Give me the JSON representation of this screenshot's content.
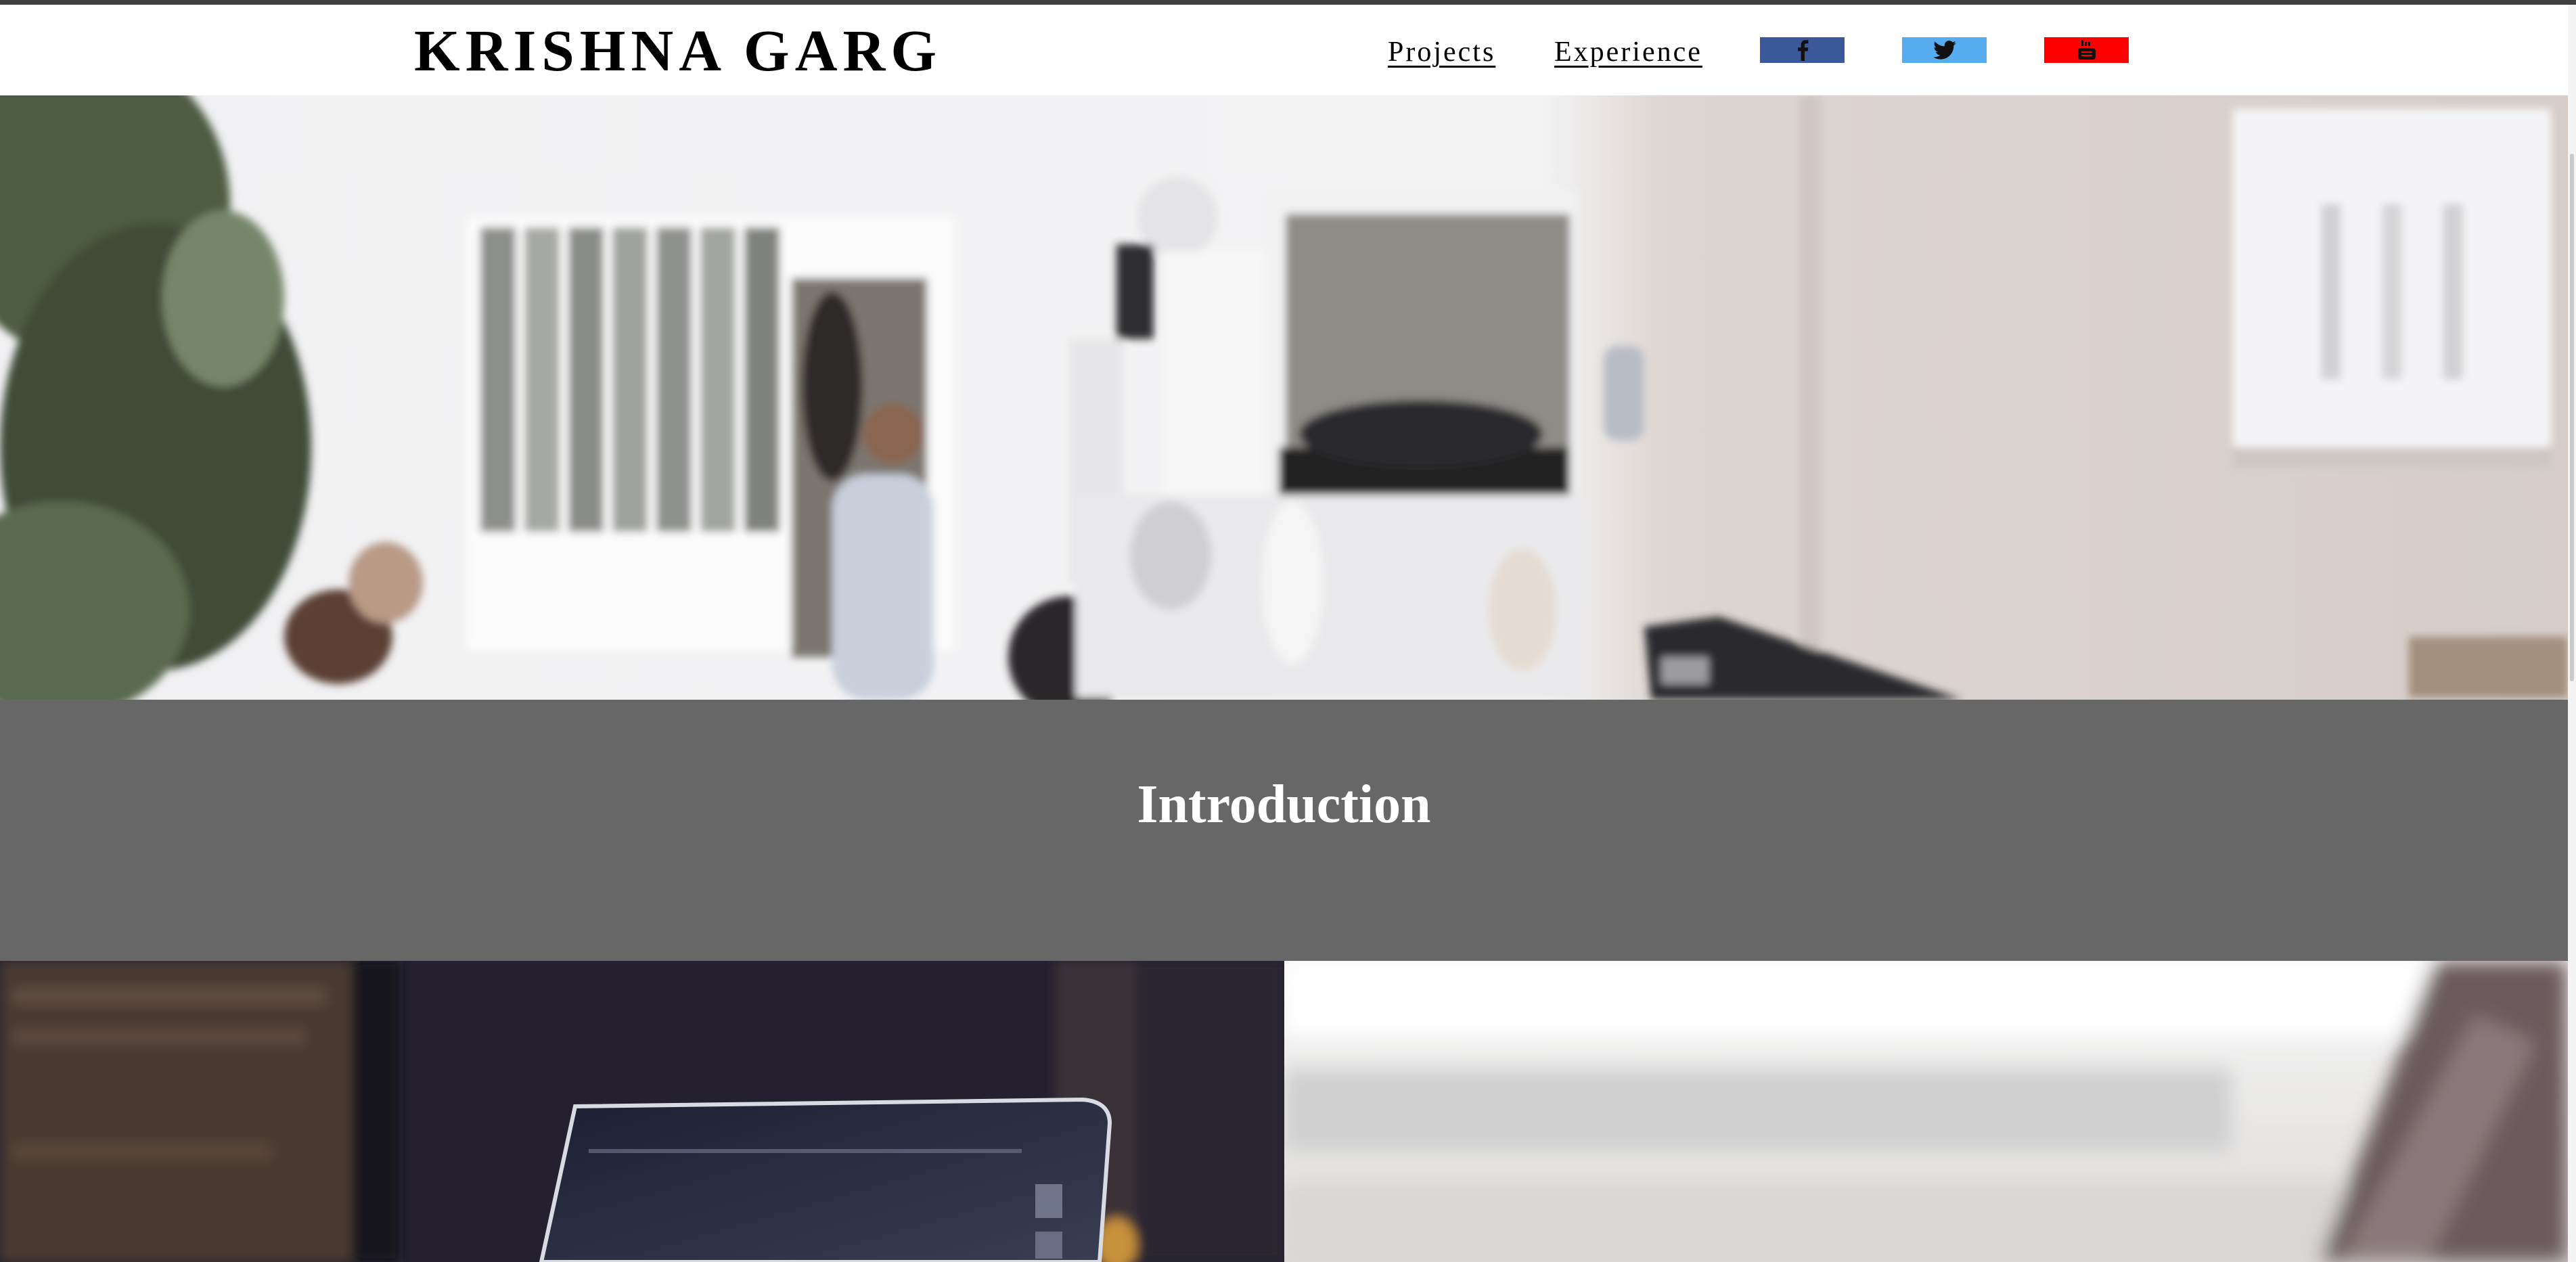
{
  "header": {
    "brand": "KRISHNA GARG",
    "nav": [
      {
        "label": "Projects"
      },
      {
        "label": "Experience"
      }
    ],
    "social": [
      {
        "name": "facebook",
        "icon": "facebook-icon",
        "color": "#3b5998"
      },
      {
        "name": "twitter",
        "icon": "twitter-icon",
        "color": "#55acee"
      },
      {
        "name": "youtube",
        "icon": "youtube-icon",
        "color": "#ff0000"
      }
    ]
  },
  "hero": {
    "image": "blurred photo of a bright white studio space with people"
  },
  "intro": {
    "title": "Introduction",
    "background": "#676767"
  },
  "cards": [
    {
      "image": "laptop on a dark desk"
    },
    {
      "image": "blurred laptop near a bright window"
    }
  ]
}
